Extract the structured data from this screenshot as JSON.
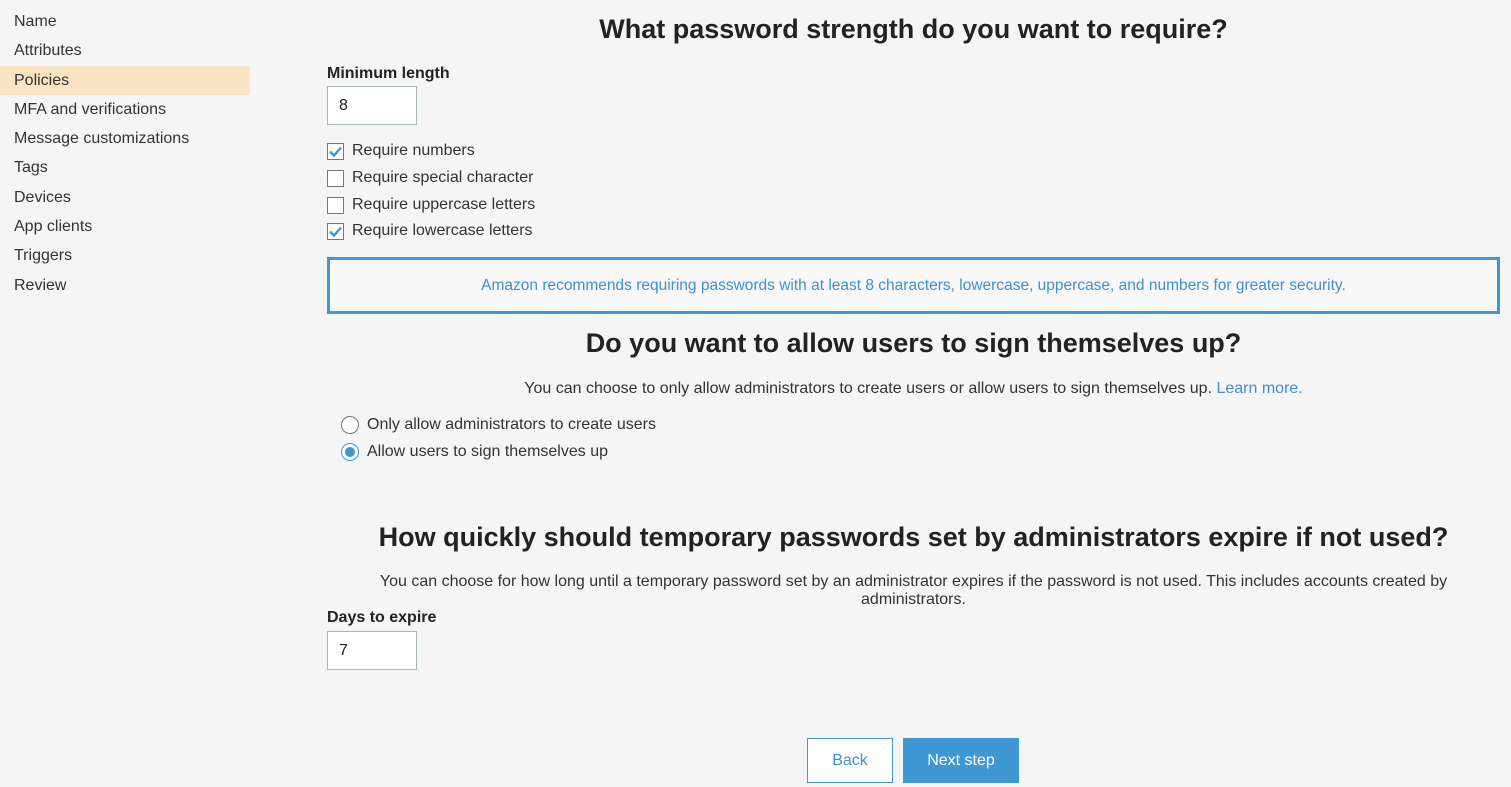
{
  "sidebar": {
    "items": [
      {
        "label": "Name",
        "active": false
      },
      {
        "label": "Attributes",
        "active": false
      },
      {
        "label": "Policies",
        "active": true
      },
      {
        "label": "MFA and verifications",
        "active": false
      },
      {
        "label": "Message customizations",
        "active": false
      },
      {
        "label": "Tags",
        "active": false
      },
      {
        "label": "Devices",
        "active": false
      },
      {
        "label": "App clients",
        "active": false
      },
      {
        "label": "Triggers",
        "active": false
      },
      {
        "label": "Review",
        "active": false
      }
    ]
  },
  "password": {
    "heading": "What password strength do you want to require?",
    "min_length_label": "Minimum length",
    "min_length_value": "8",
    "options": [
      {
        "label": "Require numbers",
        "checked": true
      },
      {
        "label": "Require special character",
        "checked": false
      },
      {
        "label": "Require uppercase letters",
        "checked": false
      },
      {
        "label": "Require lowercase letters",
        "checked": true
      }
    ],
    "recommendation": "Amazon recommends requiring passwords with at least 8 characters, lowercase, uppercase, and numbers for greater security."
  },
  "signup": {
    "heading": "Do you want to allow users to sign themselves up?",
    "description": "You can choose to only allow administrators to create users or allow users to sign themselves up.",
    "learn_more": "Learn more.",
    "options": [
      {
        "label": "Only allow administrators to create users",
        "selected": false
      },
      {
        "label": "Allow users to sign themselves up",
        "selected": true
      }
    ]
  },
  "expiry": {
    "heading": "How quickly should temporary passwords set by administrators expire if not used?",
    "description": "You can choose for how long until a temporary password set by an administrator expires if the password is not used. This includes accounts created by administrators.",
    "days_label": "Days to expire",
    "days_value": "7"
  },
  "buttons": {
    "back": "Back",
    "next": "Next step"
  },
  "colors": {
    "accent": "#3f97d3",
    "active_nav": "#fae3c3",
    "background": "#f4f5f4"
  }
}
